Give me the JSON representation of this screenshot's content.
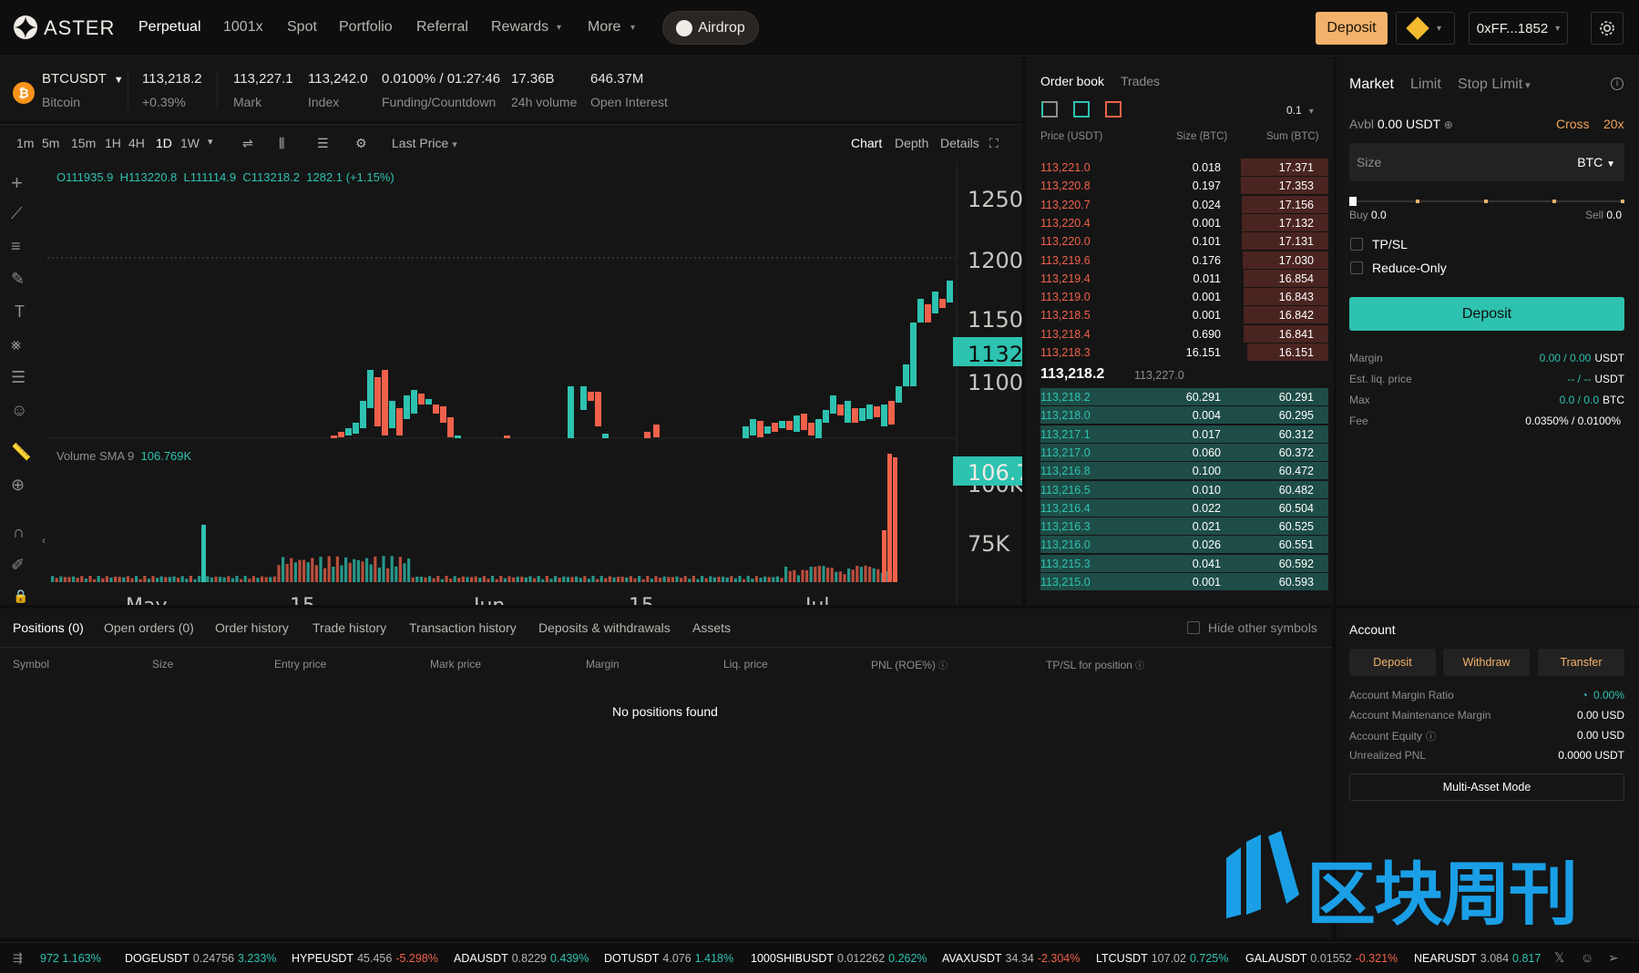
{
  "nav": {
    "logo_text": "ASTER",
    "items": [
      "Perpetual",
      "1001x",
      "Spot",
      "Portfolio",
      "Referral",
      "Rewards",
      "More"
    ],
    "airdrop": "Airdrop",
    "deposit": "Deposit",
    "wallet": "0xFF...1852",
    "accent": "#f2b26b"
  },
  "ticker": {
    "symbol": "BTCUSDT",
    "name": "Bitcoin",
    "last_price": "113,218.2",
    "change": "+0.39%",
    "mark_value": "113,227.1",
    "mark_label": "Mark",
    "index_value": "113,242.0",
    "index_label": "Index",
    "funding_value": "0.0100% / 01:27:46",
    "funding_label": "Funding/Countdown",
    "volume_value": "17.36B",
    "volume_label": "24h volume",
    "oi_value": "646.37M",
    "oi_label": "Open Interest"
  },
  "chart_toolbar": {
    "timeframes": [
      "1m",
      "5m",
      "15m",
      "1H",
      "4H",
      "1D",
      "1W"
    ],
    "active_timeframe": "1D",
    "price_type": "Last Price",
    "views": [
      "Chart",
      "Depth",
      "Details"
    ]
  },
  "chart_data": {
    "type": "candlestick",
    "ohlc_label": {
      "o": "O111935.9",
      "h": "H113220.8",
      "l": "L111114.9",
      "c": "C113218.2",
      "chg": "1282.1 (+1.15%)"
    },
    "price_axis_ticks": [
      "1250",
      "1200",
      "1150",
      "1100"
    ],
    "current_price_tag": "1132",
    "volume_label": "Volume SMA 9",
    "volume_value": "106.769K",
    "volume_tag": "106.7",
    "volume_axis_ticks": [
      "100K",
      "75K"
    ],
    "x_ticks": [
      "May",
      "15",
      "Jun",
      "15",
      "Jul"
    ],
    "colors": {
      "up": "#2ec2b0",
      "down": "#f0614b"
    }
  },
  "orderbook": {
    "tabs": [
      "Order book",
      "Trades"
    ],
    "precision": "0.1",
    "headers": [
      "Price (USDT)",
      "Size (BTC)",
      "Sum (BTC)"
    ],
    "asks": [
      [
        "113,221.0",
        "0.018",
        "17.371"
      ],
      [
        "113,220.8",
        "0.197",
        "17.353"
      ],
      [
        "113,220.7",
        "0.024",
        "17.156"
      ],
      [
        "113,220.4",
        "0.001",
        "17.132"
      ],
      [
        "113,220.0",
        "0.101",
        "17.131"
      ],
      [
        "113,219.6",
        "0.176",
        "17.030"
      ],
      [
        "113,219.4",
        "0.011",
        "16.854"
      ],
      [
        "113,219.0",
        "0.001",
        "16.843"
      ],
      [
        "113,218.5",
        "0.001",
        "16.842"
      ],
      [
        "113,218.4",
        "0.690",
        "16.841"
      ],
      [
        "113,218.3",
        "16.151",
        "16.151"
      ]
    ],
    "mid_price": "113,218.2",
    "mid_mark": "113,227.0",
    "bids": [
      [
        "113,218.2",
        "60.291",
        "60.291"
      ],
      [
        "113,218.0",
        "0.004",
        "60.295"
      ],
      [
        "113,217.1",
        "0.017",
        "60.312"
      ],
      [
        "113,217.0",
        "0.060",
        "60.372"
      ],
      [
        "113,216.8",
        "0.100",
        "60.472"
      ],
      [
        "113,216.5",
        "0.010",
        "60.482"
      ],
      [
        "113,216.4",
        "0.022",
        "60.504"
      ],
      [
        "113,216.3",
        "0.021",
        "60.525"
      ],
      [
        "113,216.0",
        "0.026",
        "60.551"
      ],
      [
        "113,215.3",
        "0.041",
        "60.592"
      ],
      [
        "113,215.0",
        "0.001",
        "60.593"
      ]
    ]
  },
  "form": {
    "tabs": [
      "Market",
      "Limit",
      "Stop Limit"
    ],
    "avbl_label": "Avbl",
    "avbl_value": "0.00 USDT",
    "margin_mode": "Cross",
    "leverage": "20x",
    "size_placeholder": "Size",
    "size_unit": "BTC",
    "buy_label": "Buy",
    "buy_value": "0.0",
    "sell_label": "Sell",
    "sell_value": "0.0",
    "tpsl": "TP/SL",
    "reduce_only": "Reduce-Only",
    "deposit_button": "Deposit",
    "stats": [
      {
        "label": "Margin",
        "value": "0.00 / 0.00",
        "unit": "USDT"
      },
      {
        "label": "Est. liq. price",
        "value": "-- / --",
        "unit": "USDT"
      },
      {
        "label": "Max",
        "value": "0.0 / 0.0",
        "unit": "BTC"
      },
      {
        "label": "Fee",
        "value": "0.0350% / 0.0100%",
        "unit": ""
      }
    ]
  },
  "positions": {
    "tabs": [
      "Positions (0)",
      "Open orders (0)",
      "Order history",
      "Trade history",
      "Transaction history",
      "Deposits & withdrawals",
      "Assets"
    ],
    "hide_other": "Hide other symbols",
    "columns": [
      "Symbol",
      "Size",
      "Entry price",
      "Mark price",
      "Margin",
      "Liq. price",
      "PNL (ROE%)",
      "TP/SL for position"
    ],
    "empty": "No positions found"
  },
  "account": {
    "title": "Account",
    "buttons": [
      "Deposit",
      "Withdraw",
      "Transfer"
    ],
    "rows": [
      {
        "label": "Account Margin Ratio",
        "value": "0.00%"
      },
      {
        "label": "Account Maintenance Margin",
        "value": "0.00 USD"
      },
      {
        "label": "Account Equity",
        "value": "0.00 USD"
      },
      {
        "label": "Unrealized PNL",
        "value": "0.0000 USDT"
      }
    ],
    "multi_asset": "Multi-Asset Mode"
  },
  "watermark": "区块周刊",
  "footer": [
    {
      "sym": "",
      "price": "",
      "chg": "972 1.163%",
      "dir": "up"
    },
    {
      "sym": "DOGEUSDT",
      "price": "0.24756",
      "chg": "3.233%",
      "dir": "up"
    },
    {
      "sym": "HYPEUSDT",
      "price": "45.456",
      "chg": "-5.298%",
      "dir": "down"
    },
    {
      "sym": "ADAUSDT",
      "price": "0.8229",
      "chg": "0.439%",
      "dir": "up"
    },
    {
      "sym": "DOTUSDT",
      "price": "4.076",
      "chg": "1.418%",
      "dir": "up"
    },
    {
      "sym": "1000SHIBUSDT",
      "price": "0.012262",
      "chg": "0.262%",
      "dir": "up"
    },
    {
      "sym": "AVAXUSDT",
      "price": "34.34",
      "chg": "-2.304%",
      "dir": "down"
    },
    {
      "sym": "LTCUSDT",
      "price": "107.02",
      "chg": "0.725%",
      "dir": "up"
    },
    {
      "sym": "GALAUSDT",
      "price": "0.01552",
      "chg": "-0.321%",
      "dir": "down"
    },
    {
      "sym": "NEARUSDT",
      "price": "3.084",
      "chg": "0.817",
      "dir": "up"
    }
  ]
}
